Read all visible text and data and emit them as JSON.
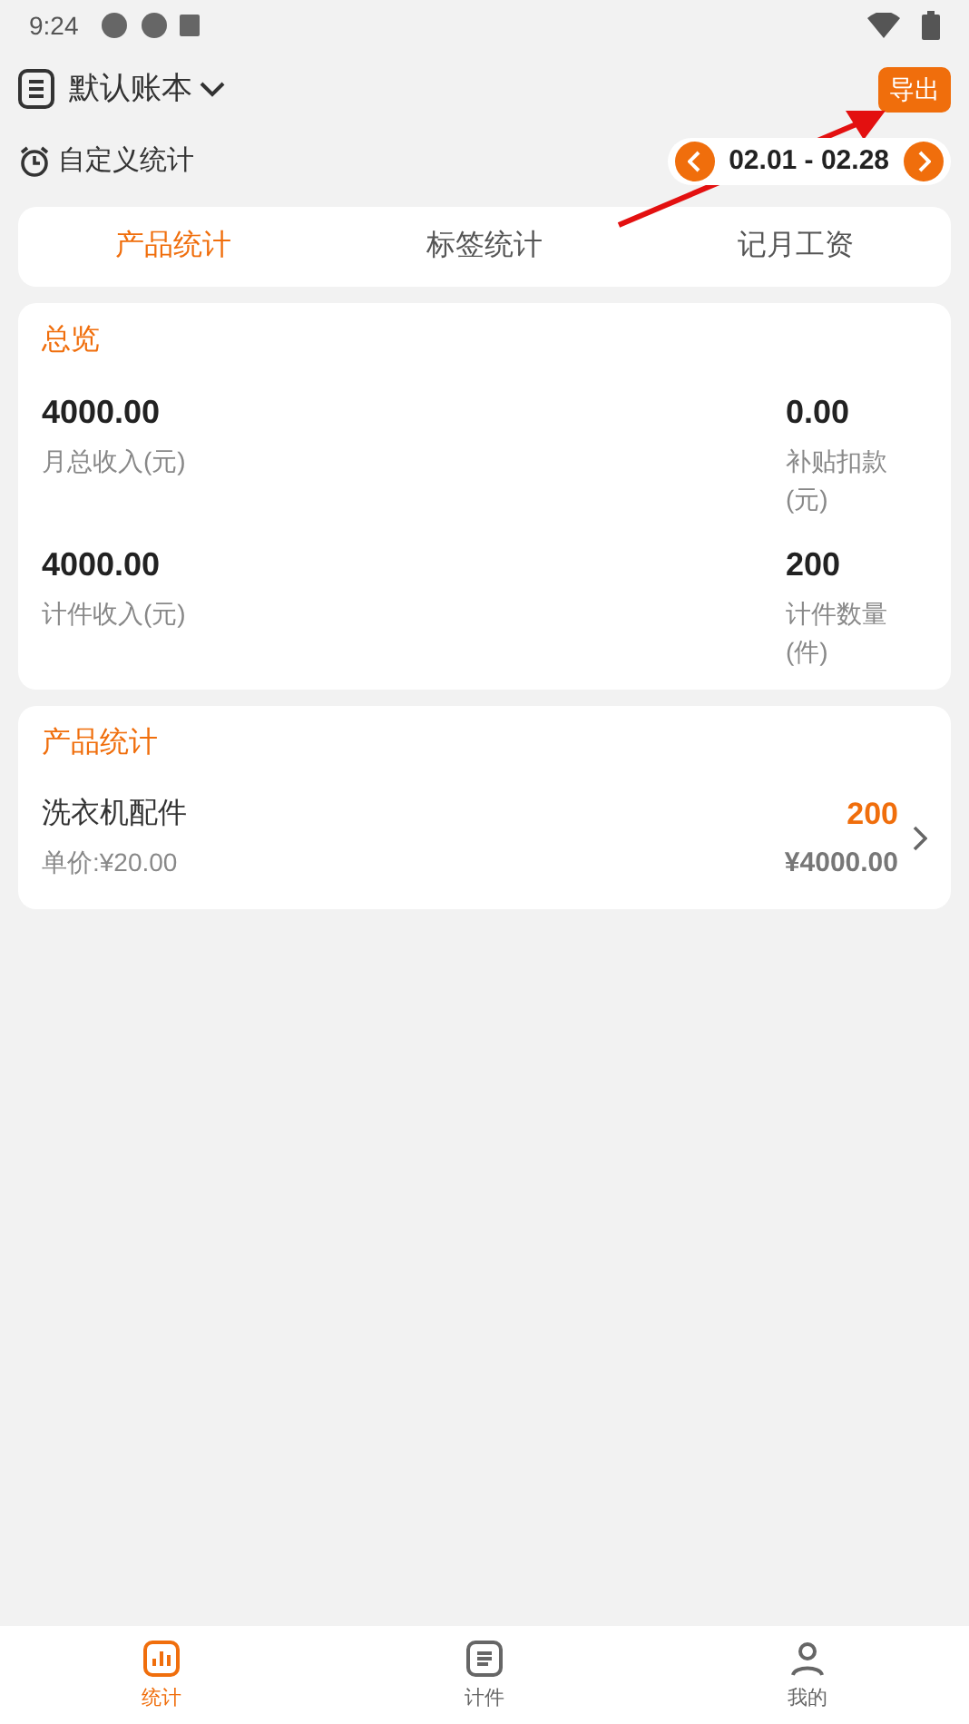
{
  "status_bar": {
    "time": "9:24"
  },
  "header": {
    "book": "默认账本",
    "export": "导出"
  },
  "filter": {
    "label": "自定义统计",
    "range": "02.01 - 02.28"
  },
  "tabs": [
    {
      "label": "产品统计",
      "selected": true
    },
    {
      "label": "标签统计",
      "selected": false
    },
    {
      "label": "记月工资",
      "selected": false
    }
  ],
  "overview": {
    "title": "总览",
    "stats": [
      {
        "value": "4000.00",
        "label": "月总收入(元)"
      },
      {
        "value": "0.00",
        "label": "补贴扣款(元)"
      },
      {
        "value": "4000.00",
        "label": "计件收入(元)"
      },
      {
        "value": "200",
        "label": "计件数量(件)"
      }
    ]
  },
  "products": {
    "title": "产品统计",
    "items": [
      {
        "name": "洗衣机配件",
        "unit_price": "单价:¥20.00",
        "count": "200",
        "total": "¥4000.00"
      }
    ]
  },
  "bottom_nav": [
    {
      "label": "统计",
      "kind": "chart",
      "selected": true
    },
    {
      "label": "计件",
      "kind": "list",
      "selected": false
    },
    {
      "label": "我的",
      "kind": "user",
      "selected": false
    }
  ]
}
